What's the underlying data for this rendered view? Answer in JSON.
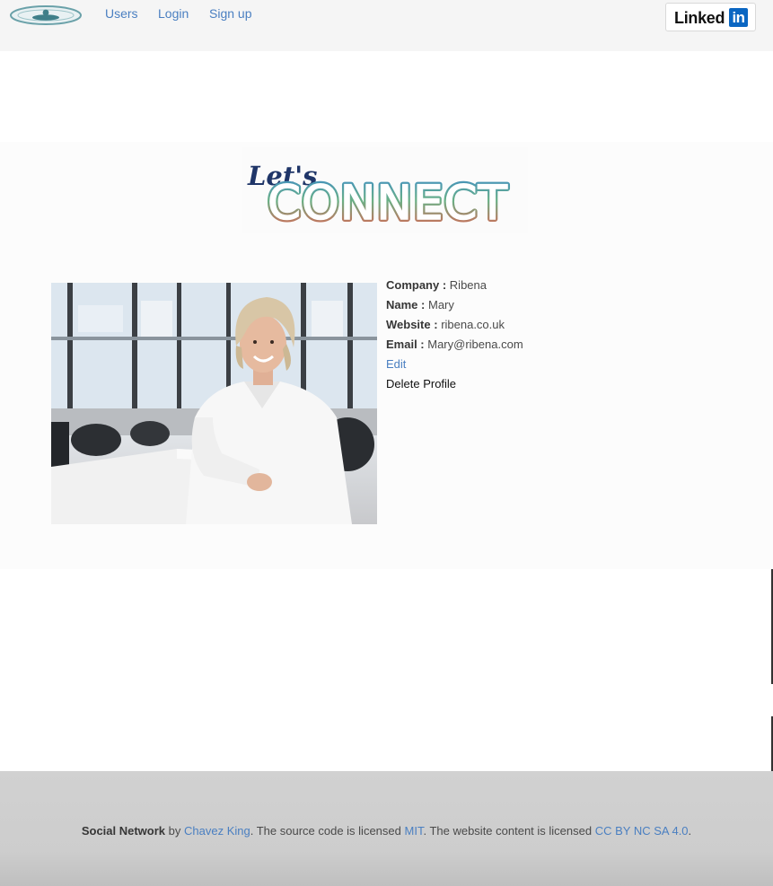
{
  "navbar": {
    "logo_icon": "site-logo-icon",
    "links": {
      "users": "Users",
      "login": "Login",
      "signup": "Sign up"
    },
    "linkedin": {
      "word": "Linked",
      "box": "in",
      "brand_color": "#0a66c2"
    }
  },
  "hero": {
    "banner": {
      "small_text": "Let's",
      "big_text": "CONNECT"
    }
  },
  "profile": {
    "photo_icon": "profile-photo",
    "company_label": "Company :",
    "company_value": "Ribena",
    "name_label": "Name :",
    "name_value": "Mary",
    "website_label": "Website :",
    "website_value": "ribena.co.uk",
    "email_label": "Email :",
    "email_value": "Mary@ribena.com",
    "edit_label": "Edit",
    "delete_label": "Delete Profile"
  },
  "footer": {
    "site_name": "Social Network",
    "by": "by",
    "author": "Chavez King",
    "code_text": ". The source code is licensed",
    "code_license": "MIT",
    "content_text": ". The website content is licensed",
    "content_license": "CC BY NC SA 4.0",
    "end": "."
  },
  "colors": {
    "link": "#4a7fc1",
    "navbar_bg": "#f5f5f5",
    "footer_bg": "#d1d1d1"
  }
}
